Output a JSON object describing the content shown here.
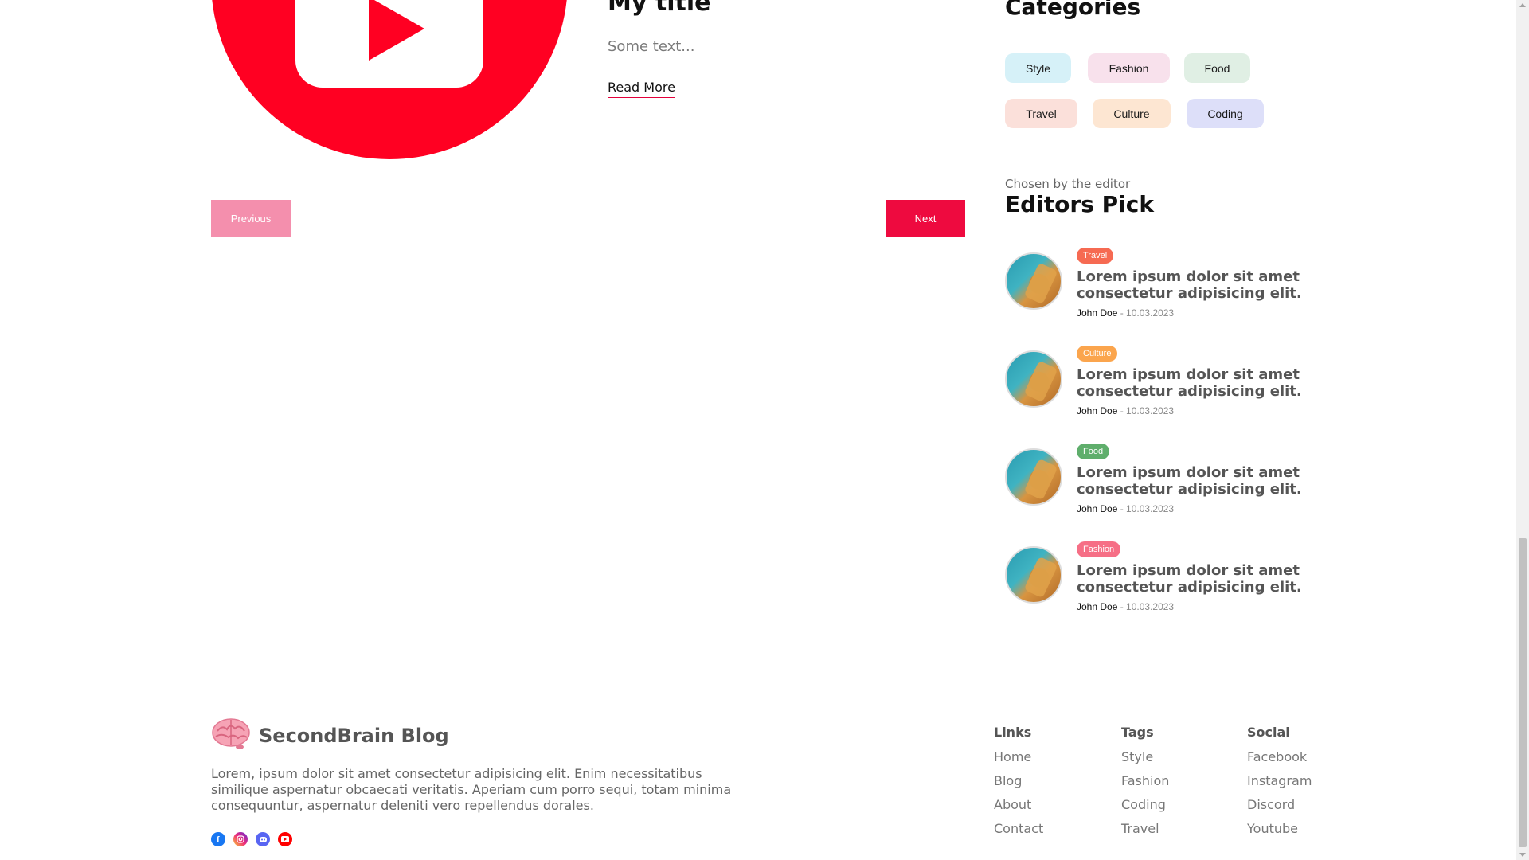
{
  "post": {
    "title": "My title",
    "description": "Some text...",
    "read_more": "Read More",
    "image_icon": "youtube-logo"
  },
  "pagination": {
    "previous": "Previous",
    "next": "Next"
  },
  "categories": {
    "title": "Categories",
    "items": [
      {
        "label": "Style",
        "color": "#d6f1f8"
      },
      {
        "label": "Fashion",
        "color": "#f8e1ec"
      },
      {
        "label": "Food",
        "color": "#e0efe4"
      },
      {
        "label": "Travel",
        "color": "#fbe0da"
      },
      {
        "label": "Culture",
        "color": "#fde6d2"
      },
      {
        "label": "Coding",
        "color": "#dddff9"
      }
    ]
  },
  "editors_pick": {
    "subtitle": "Chosen by the editor",
    "title": "Editors Pick",
    "items": [
      {
        "tag": "Travel",
        "tag_color": "#f66a52",
        "text": "Lorem ipsum dolor sit amet consectetur adipisicing elit.",
        "author": "John Doe",
        "date": " - 10.03.2023"
      },
      {
        "tag": "Culture",
        "tag_color": "#fba54d",
        "text": "Lorem ipsum dolor sit amet consectetur adipisicing elit.",
        "author": "John Doe",
        "date": " - 10.03.2023"
      },
      {
        "tag": "Food",
        "tag_color": "#5fae6c",
        "text": "Lorem ipsum dolor sit amet consectetur adipisicing elit.",
        "author": "John Doe",
        "date": " - 10.03.2023"
      },
      {
        "tag": "Fashion",
        "tag_color": "#f66f86",
        "text": "Lorem ipsum dolor sit amet consectetur adipisicing elit.",
        "author": "John Doe",
        "date": " - 10.03.2023"
      }
    ]
  },
  "footer": {
    "brand": "SecondBrain Blog",
    "brand_icon": "brain-icon",
    "description": "Lorem, ipsum dolor sit amet consectetur adipisicing elit. Enim necessitatibus similique aspernatur obcaecati veritatis. Aperiam cum porro sequi, totam minima consequuntur, aspernatur deleniti vero repellendus dorales.",
    "social_icons": [
      {
        "name": "facebook-icon",
        "color": "#1877f2"
      },
      {
        "name": "instagram-icon",
        "color": "#d6249f"
      },
      {
        "name": "discord-icon",
        "color": "#5865f2"
      },
      {
        "name": "youtube-icon",
        "color": "#ff0000"
      }
    ],
    "columns": [
      {
        "title": "Links",
        "items": [
          "Home",
          "Blog",
          "About",
          "Contact"
        ]
      },
      {
        "title": "Tags",
        "items": [
          "Style",
          "Fashion",
          "Coding",
          "Travel"
        ]
      },
      {
        "title": "Social",
        "items": [
          "Facebook",
          "Instagram",
          "Discord",
          "Youtube"
        ]
      }
    ]
  }
}
